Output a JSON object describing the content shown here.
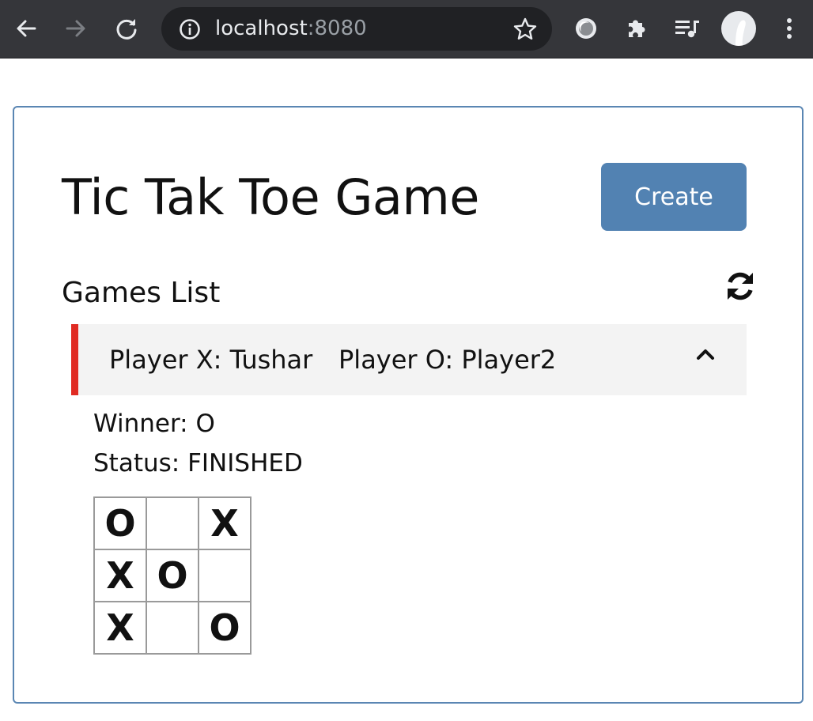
{
  "browser": {
    "url_host": "localhost",
    "url_port": ":8080"
  },
  "page": {
    "title": "Tic Tak Toe Game",
    "create_label": "Create",
    "games_heading": "Games List"
  },
  "game": {
    "player_x": "Player X: Tushar",
    "player_o": "Player O: Player2",
    "winner": "Winner: O",
    "status": "Status: FINISHED",
    "board": [
      [
        "O",
        "",
        "X"
      ],
      [
        "X",
        "O",
        ""
      ],
      [
        "X",
        "",
        "O"
      ]
    ]
  },
  "colors": {
    "accent": "#5282b2",
    "card_border": "#5a86b3",
    "row_marker": "#e02b23",
    "row_bg": "#f3f3f3"
  },
  "icons": [
    "back-arrow-icon",
    "forward-arrow-icon",
    "reload-icon",
    "info-icon",
    "star-icon",
    "extension-icon",
    "puzzle-icon",
    "media-queue-icon",
    "avatar",
    "kebab-menu-icon",
    "refresh-icon",
    "chevron-up-icon"
  ]
}
